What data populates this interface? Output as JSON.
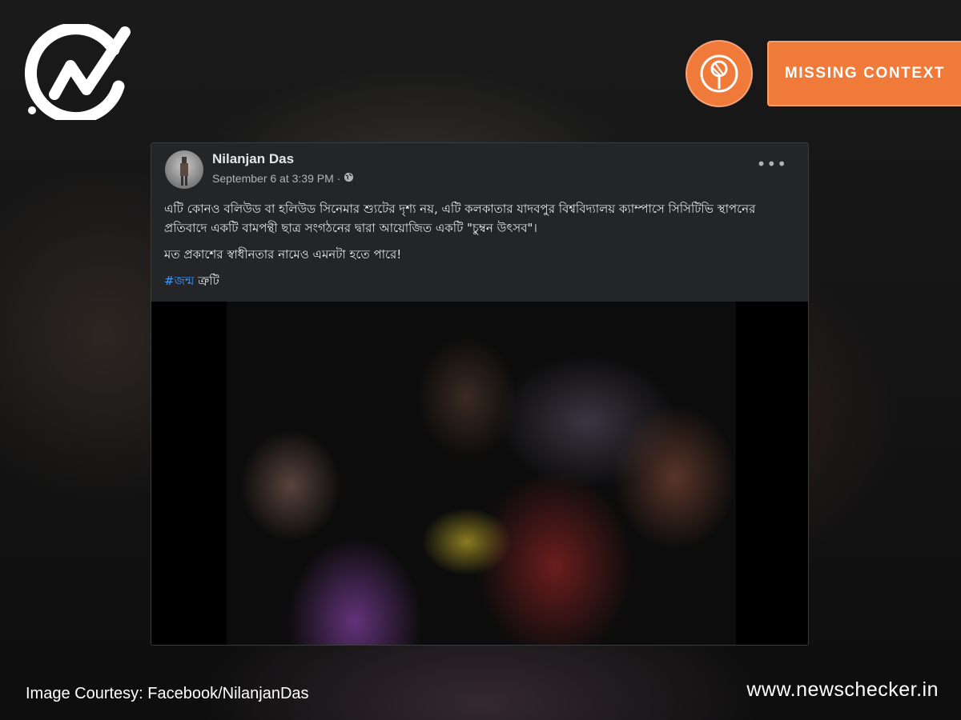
{
  "colors": {
    "accent": "#f07a3a",
    "hashtag": "#4599ff",
    "card_bg": "#242526"
  },
  "brand": {
    "logo_icon": "newschecker-check-icon"
  },
  "verdict": {
    "label": "MISSING CONTEXT",
    "icon": "magnifier-stamp-icon"
  },
  "post": {
    "author": "Nilanjan Das",
    "timestamp": "September 6 at 3:39 PM",
    "separator": "·",
    "privacy_icon": "globe-icon",
    "menu_icon": "more-options-icon",
    "more_label": "•••",
    "text_line_1": "এটি কোনও বলিউড বা হলিউড সিনেমার শ্যুটের দৃশ্য নয়, এটি কলকাতার যাদবপুর বিশ্ববিদ্যালয় ক্যাম্পাসে সিসিটিভি স্থাপনের প্রতিবাদে একটি বামপন্থী ছাত্র সংগঠনের দ্বারা আয়োজিত একটি \"চুম্বন উৎসব\"।",
    "text_line_2": "মত প্রকাশের স্বাধীনতার নামেও এমনটা হতে পারে!",
    "hashtag": "#জন্ম",
    "hashtag_suffix": "ত্রুটি"
  },
  "footer": {
    "credit": "Image Courtesy: Facebook/NilanjanDas",
    "site": "www.newschecker.in"
  }
}
